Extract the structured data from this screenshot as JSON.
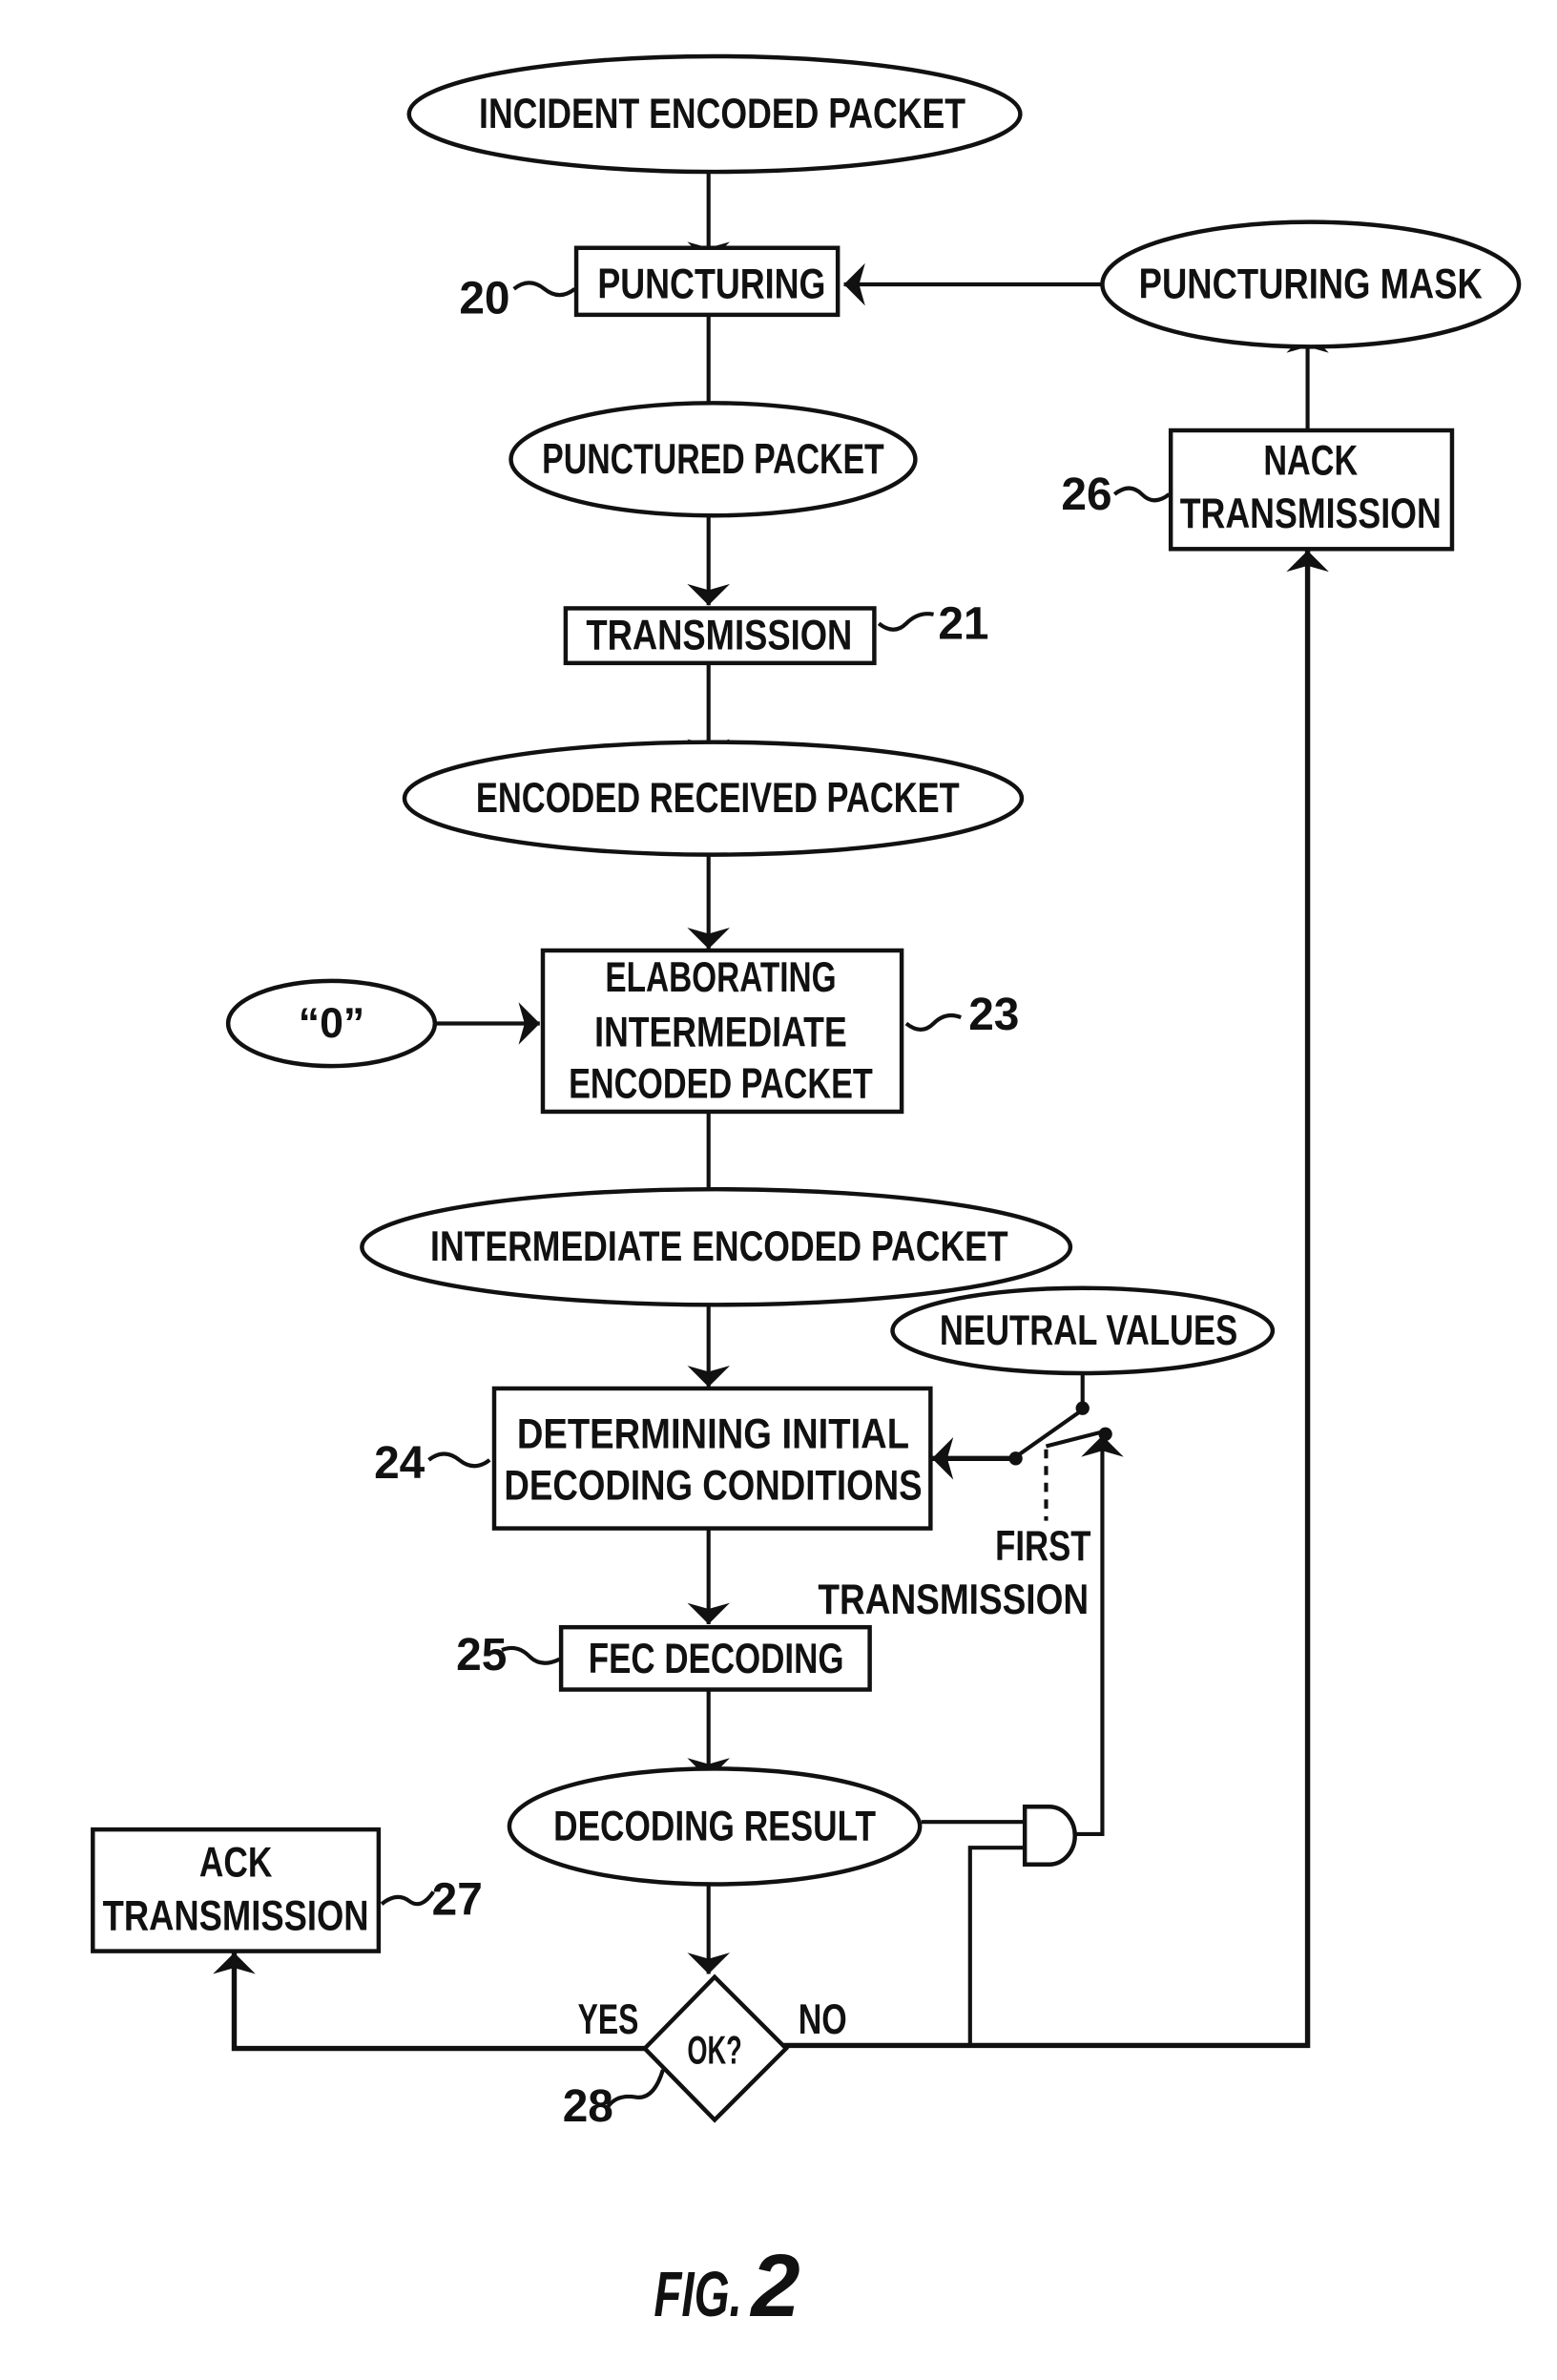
{
  "figure": {
    "caption_prefix": "FIG.",
    "caption_number": "2"
  },
  "nodes": {
    "incident_encoded_packet": "INCIDENT ENCODED PACKET",
    "puncturing": "PUNCTURING",
    "puncturing_mask": "PUNCTURING MASK",
    "punctured_packet": "PUNCTURED PACKET",
    "nack_transmission": [
      "NACK",
      "TRANSMISSION"
    ],
    "transmission": "TRANSMISSION",
    "encoded_received_packet": "ENCODED RECEIVED PACKET",
    "zero_input": "“0”",
    "elaborating": [
      "ELABORATING",
      "INTERMEDIATE",
      "ENCODED PACKET"
    ],
    "intermediate_encoded_packet": "INTERMEDIATE ENCODED PACKET",
    "neutral_values": "NEUTRAL VALUES",
    "determining": [
      "DETERMINING INITIAL",
      "DECODING CONDITIONS"
    ],
    "first_transmission": [
      "FIRST",
      "TRANSMISSION"
    ],
    "fec_decoding": "FEC DECODING",
    "decoding_result": "DECODING RESULT",
    "ack_transmission": [
      "ACK",
      "TRANSMISSION"
    ],
    "ok_decision": "OK?",
    "yes_label": "YES",
    "no_label": "NO"
  },
  "refs": {
    "puncturing": "20",
    "transmission": "21",
    "elaborating": "23",
    "determining": "24",
    "fec_decoding": "25",
    "nack_transmission": "26",
    "ack_transmission": "27",
    "ok_decision": "28"
  }
}
